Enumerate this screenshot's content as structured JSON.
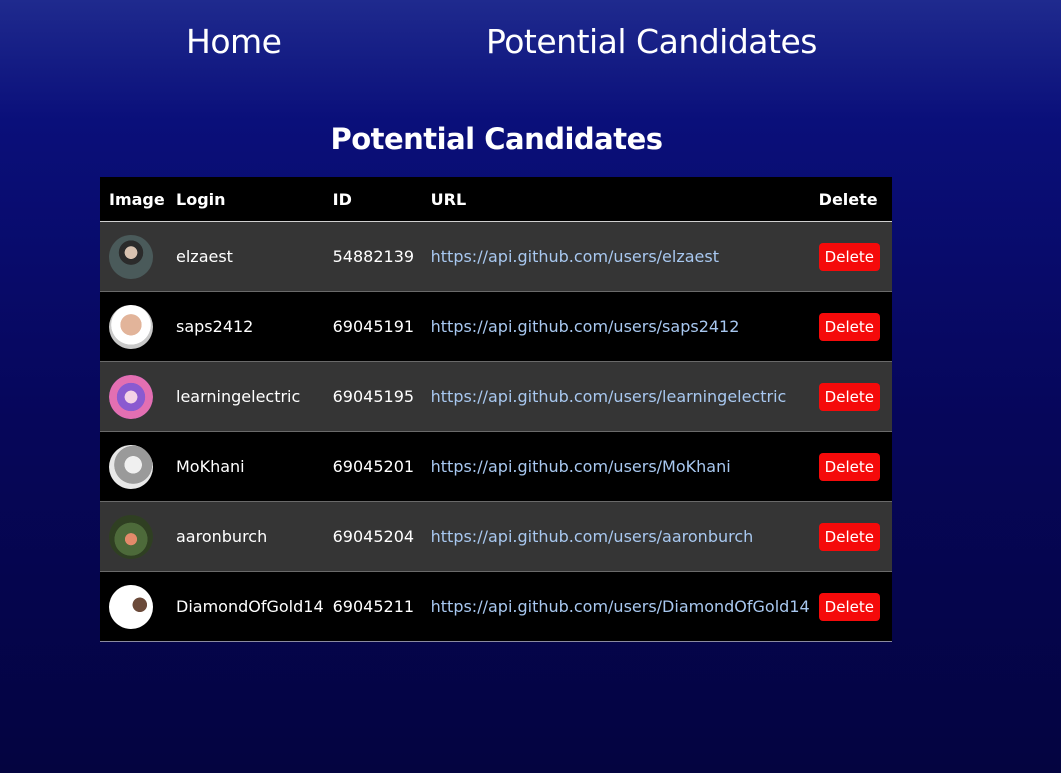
{
  "nav": {
    "home": "Home",
    "candidates": "Potential Candidates"
  },
  "page_title": "Potential Candidates",
  "table": {
    "headers": {
      "image": "Image",
      "login": "Login",
      "id": "ID",
      "url": "URL",
      "delete": "Delete"
    },
    "rows": [
      {
        "avatar": "avatar-image",
        "login": "elzaest",
        "id": "54882139",
        "url": "https://api.github.com/users/elzaest",
        "delete_label": "Delete"
      },
      {
        "avatar": "avatar-image",
        "login": "saps2412",
        "id": "69045191",
        "url": "https://api.github.com/users/saps2412",
        "delete_label": "Delete"
      },
      {
        "avatar": "avatar-image",
        "login": "learningelectric",
        "id": "69045195",
        "url": "https://api.github.com/users/learningelectric",
        "delete_label": "Delete"
      },
      {
        "avatar": "avatar-image",
        "login": "MoKhani",
        "id": "69045201",
        "url": "https://api.github.com/users/MoKhani",
        "delete_label": "Delete"
      },
      {
        "avatar": "avatar-image",
        "login": "aaronburch",
        "id": "69045204",
        "url": "https://api.github.com/users/aaronburch",
        "delete_label": "Delete"
      },
      {
        "avatar": "avatar-image",
        "login": "DiamondOfGold14",
        "id": "69045211",
        "url": "https://api.github.com/users/DiamondOfGold14",
        "delete_label": "Delete"
      }
    ]
  },
  "colors": {
    "background_top": "#1f2a8e",
    "background_bottom": "#040440",
    "delete_button": "#f50a0a",
    "url_link": "#a8c8f0",
    "row_odd": "#353535",
    "row_even": "#000000"
  }
}
